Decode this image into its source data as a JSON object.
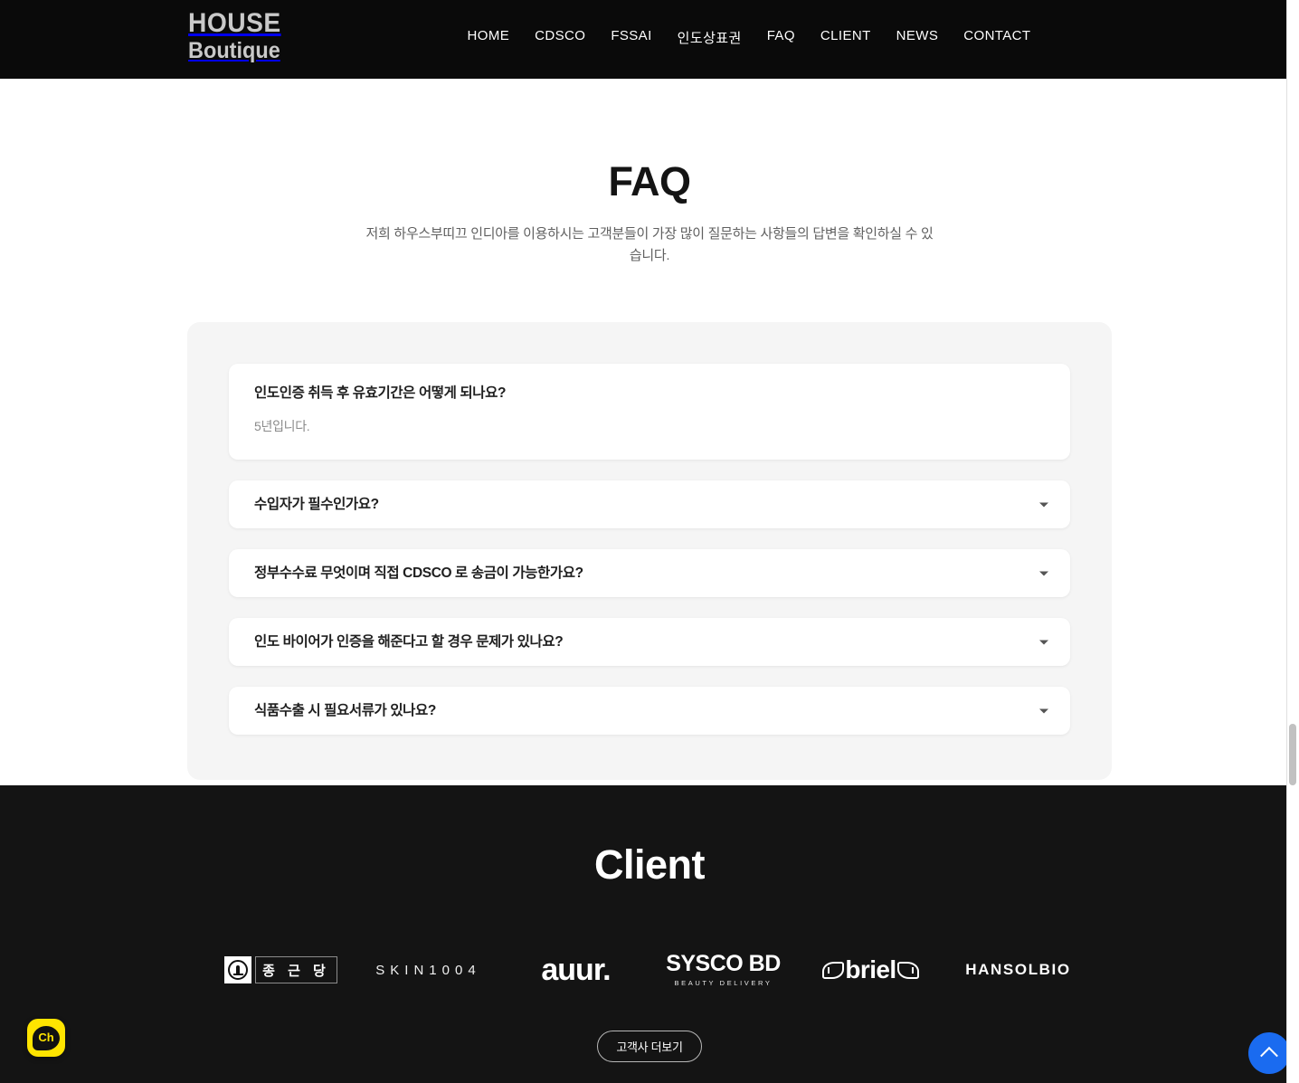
{
  "header": {
    "logo_top": "HOUSE",
    "logo_bottom": "Boutique",
    "nav": [
      {
        "label": "HOME"
      },
      {
        "label": "CDSCO"
      },
      {
        "label": "FSSAI"
      },
      {
        "label": "인도상표권"
      },
      {
        "label": "FAQ"
      },
      {
        "label": "CLIENT"
      },
      {
        "label": "NEWS"
      },
      {
        "label": "CONTACT"
      }
    ]
  },
  "faq": {
    "title": "FAQ",
    "subtitle": "저희 하우스부띠끄 인디아를 이용하시는 고객분들이 가장 많이 질문하는 사항들의 답변을 확인하실 수 있습니다.",
    "items": [
      {
        "question": "인도인증 취득 후 유효기간은 어떻게 되나요?",
        "answer": "5년입니다.",
        "expanded": true
      },
      {
        "question": "수입자가 필수인가요?",
        "answer": "",
        "expanded": false
      },
      {
        "question": "정부수수료 무엇이며 직접 CDSCO 로 송금이 가능한가요?",
        "answer": "",
        "expanded": false
      },
      {
        "question": "인도 바이어가 인증을 해준다고 할 경우 문제가 있나요?",
        "answer": "",
        "expanded": false
      },
      {
        "question": "식품수출 시 필요서류가 있나요?",
        "answer": "",
        "expanded": false
      }
    ]
  },
  "client": {
    "title": "Client",
    "logos": [
      {
        "name": "종근당",
        "text": "종 근 당",
        "kind": "ckd"
      },
      {
        "name": "SKIN1004",
        "text": "SKIN1004",
        "kind": "skin1004"
      },
      {
        "name": "auur",
        "text": "auur.",
        "kind": "auur"
      },
      {
        "name": "SYSCO BD",
        "text": "SYSCO BD",
        "subtext": "BEAUTY DELIVERY",
        "kind": "sysco"
      },
      {
        "name": "briel",
        "text": "briel",
        "kind": "briel"
      },
      {
        "name": "HANSOLBIO",
        "text": "HANSOLBIO",
        "kind": "hansolbio"
      }
    ],
    "more_button": "고객사 더보기"
  },
  "widgets": {
    "chat_label": "Ch",
    "scroll_top_icon": "chevron-up-icon"
  },
  "colors": {
    "header_bg": "#0a0a0a",
    "client_bg": "#141414",
    "panel_bg": "#f5f5f5",
    "card_bg": "#ffffff",
    "accent_blue": "#1a6bf0",
    "chat_yellow": "#ffe400"
  }
}
